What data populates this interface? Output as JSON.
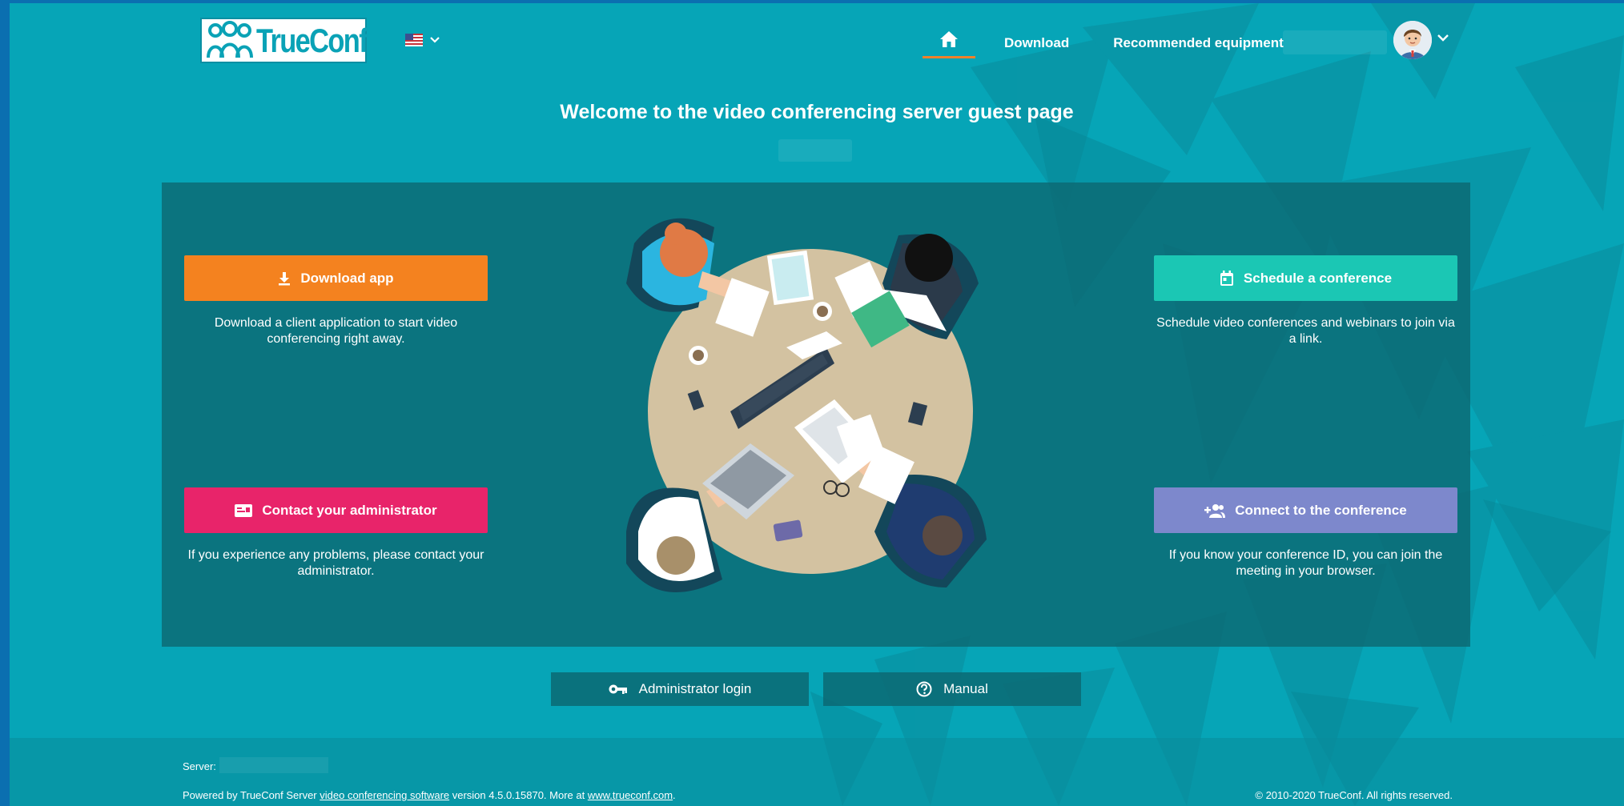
{
  "header": {
    "logo_text": "TrueConf",
    "language": "us-flag-icon",
    "nav": [
      {
        "label": "Download"
      },
      {
        "label": "Recommended equipment"
      }
    ]
  },
  "welcome": {
    "title": "Welcome to the video conferencing server guest page"
  },
  "actions": {
    "download": {
      "label": "Download app",
      "description": "Download a client application to start video conferencing right away.",
      "color": "#f4821f",
      "icon": "download-icon"
    },
    "contact": {
      "label": "Contact your administrator",
      "description": "If you experience any problems, please contact your administrator.",
      "color": "#e8246a",
      "icon": "contact-card-icon"
    },
    "schedule": {
      "label": "Schedule a conference",
      "description": "Schedule video conferences and webinars to join via a link.",
      "color": "#1bc7b4",
      "icon": "calendar-icon"
    },
    "connect": {
      "label": "Connect to the conference",
      "description": "If you know your conference ID, you can join the meeting in your browser.",
      "color": "#7d88cc",
      "icon": "add-people-icon"
    }
  },
  "links": {
    "admin_login": "Administrator login",
    "manual": "Manual"
  },
  "footer": {
    "server_label": "Server:",
    "powered_prefix": "Powered by TrueConf Server ",
    "powered_link": "video conferencing software",
    "powered_version": " version 4.5.0.15870. More at ",
    "website_link": "www.trueconf.com",
    "powered_suffix": ".",
    "copyright": "© 2010-2020 TrueConf. All rights reserved."
  },
  "colors": {
    "page_bg": "#06a5b7",
    "panel_bg": "#0c6973",
    "accent": "#f0812a"
  }
}
